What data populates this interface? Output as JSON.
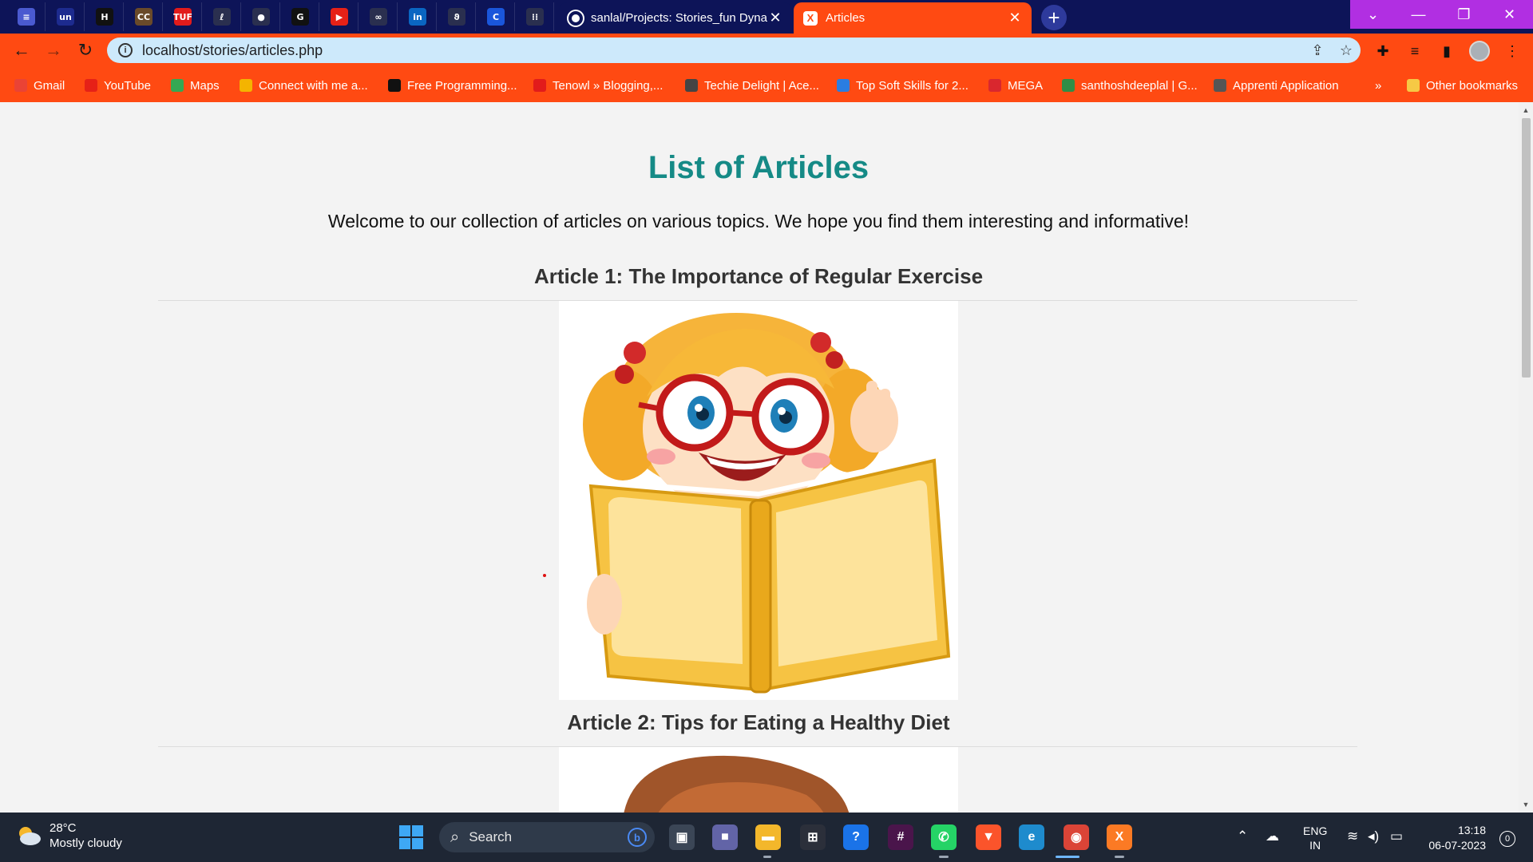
{
  "browser": {
    "pinned_tabs": [
      {
        "name": "news-tab",
        "icon": "newspaper-icon",
        "glyph": "≡",
        "color": "#4a5ad0"
      },
      {
        "name": "unstop-tab",
        "icon": "unstop-icon",
        "glyph": "un",
        "color": "#1d2b8f"
      },
      {
        "name": "hackerrank-tab",
        "icon": "hackerrank-icon",
        "glyph": "H",
        "color": "#111111"
      },
      {
        "name": "codechef-tab",
        "icon": "codechef-icon",
        "glyph": "CC",
        "color": "#6a4a2a"
      },
      {
        "name": "tuf-tab",
        "icon": "tuf-icon",
        "glyph": "TUF",
        "color": "#e21b1b"
      },
      {
        "name": "leetcode-tab",
        "icon": "leetcode-icon",
        "glyph": "ℓ",
        "color": "#2a2f4f"
      },
      {
        "name": "github-pinned-tab",
        "icon": "github-icon",
        "glyph": "●",
        "color": "#2a2f4f"
      },
      {
        "name": "codeforces-tab",
        "icon": "codeforces-icon",
        "glyph": "G",
        "color": "#111111"
      },
      {
        "name": "youtube-tab",
        "icon": "youtube-icon",
        "glyph": "▶",
        "color": "#e62117"
      },
      {
        "name": "connect-tab",
        "icon": "link-icon",
        "glyph": "∞",
        "color": "#2a2f4f"
      },
      {
        "name": "linkedin-tab",
        "icon": "linkedin-icon",
        "glyph": "in",
        "color": "#0a66c2"
      },
      {
        "name": "green-tab",
        "icon": "leaf-icon",
        "glyph": "ϑ",
        "color": "#2a2f4f"
      },
      {
        "name": "coursera-tab",
        "icon": "coursera-icon",
        "glyph": "C",
        "color": "#1a56db"
      },
      {
        "name": "cisco-tab",
        "icon": "cisco-icon",
        "glyph": "⁞⁞",
        "color": "#2a2f4f"
      }
    ],
    "tabs": [
      {
        "label": "sanlal/Projects: Stories_fun Dynamic",
        "icon": "github-icon"
      },
      {
        "label": "Articles",
        "icon": "xampp-icon"
      }
    ],
    "url": "localhost/stories/articles.php",
    "bookmarks": [
      {
        "label": "Gmail",
        "icon": "gmail-icon",
        "color": "#ea4335"
      },
      {
        "label": "YouTube",
        "icon": "youtube-icon",
        "color": "#e62117"
      },
      {
        "label": "Maps",
        "icon": "maps-icon",
        "color": "#34a853"
      },
      {
        "label": "Connect with me a...",
        "icon": "link-icon",
        "color": "#f4b400"
      },
      {
        "label": "Free Programming...",
        "icon": "freecodecamp-icon",
        "color": "#111111"
      },
      {
        "label": "Tenowl » Blogging,...",
        "icon": "tenowl-icon",
        "color": "#e21b1b"
      },
      {
        "label": "Techie Delight | Ace...",
        "icon": "techie-delight-icon",
        "color": "#444444"
      },
      {
        "label": "Top Soft Skills for 2...",
        "icon": "softskills-icon",
        "color": "#2a7de1"
      },
      {
        "label": "MEGA",
        "icon": "mega-icon",
        "color": "#d9272e"
      },
      {
        "label": "santhoshdeeplal | G...",
        "icon": "geeks-icon",
        "color": "#2f8d46"
      },
      {
        "label": "Apprenti Application",
        "icon": "apprenti-icon",
        "color": "#555555"
      }
    ],
    "other_bookmarks": "Other bookmarks",
    "overflow": "»"
  },
  "page": {
    "title": "List of Articles",
    "intro": "Welcome to our collection of articles on various topics. We hope you find them interesting and informative!",
    "articles": [
      {
        "title": "Article 1: The Importance of Regular Exercise",
        "image": "girl-reading-book-illustration"
      },
      {
        "title": "Article 2: Tips for Eating a Healthy Diet",
        "image": "boy-illustration"
      }
    ]
  },
  "taskbar": {
    "weather": {
      "temp": "28°C",
      "condition": "Mostly cloudy"
    },
    "search_placeholder": "Search",
    "apps": [
      {
        "name": "task-view",
        "icon": "task-view-icon",
        "color": "#3b4656",
        "glyph": "▣"
      },
      {
        "name": "meet",
        "icon": "video-call-icon",
        "color": "#6264a7",
        "glyph": "■"
      },
      {
        "name": "file-explorer",
        "icon": "folder-icon",
        "color": "#f3b72b",
        "glyph": "▬"
      },
      {
        "name": "store",
        "icon": "store-icon",
        "color": "#2b2f3a",
        "glyph": "⊞"
      },
      {
        "name": "help",
        "icon": "help-icon",
        "color": "#1a73e8",
        "glyph": "?"
      },
      {
        "name": "slack",
        "icon": "slack-icon",
        "color": "#4a154b",
        "glyph": "#"
      },
      {
        "name": "whatsapp",
        "icon": "whatsapp-icon",
        "color": "#25d366",
        "glyph": "✆"
      },
      {
        "name": "brave",
        "icon": "brave-icon",
        "color": "#fb542b",
        "glyph": "▼"
      },
      {
        "name": "edge",
        "icon": "edge-icon",
        "color": "#1e8bcd",
        "glyph": "e"
      },
      {
        "name": "chrome",
        "icon": "chrome-icon",
        "color": "#db4437",
        "glyph": "◉"
      },
      {
        "name": "xampp",
        "icon": "xampp-icon",
        "color": "#fb7a24",
        "glyph": "X"
      }
    ],
    "lang_line1": "ENG",
    "lang_line2": "IN",
    "time": "13:18",
    "date": "06-07-2023",
    "notifications": "0"
  }
}
